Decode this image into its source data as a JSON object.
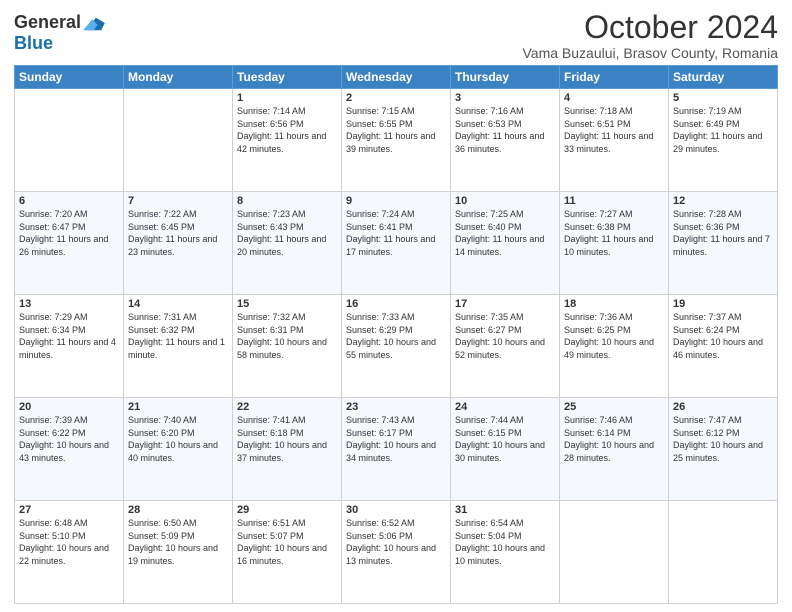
{
  "logo": {
    "general": "General",
    "blue": "Blue"
  },
  "title": "October 2024",
  "location": "Vama Buzaului, Brasov County, Romania",
  "days_of_week": [
    "Sunday",
    "Monday",
    "Tuesday",
    "Wednesday",
    "Thursday",
    "Friday",
    "Saturday"
  ],
  "weeks": [
    [
      {
        "day": "",
        "sunrise": "",
        "sunset": "",
        "daylight": ""
      },
      {
        "day": "",
        "sunrise": "",
        "sunset": "",
        "daylight": ""
      },
      {
        "day": "1",
        "sunrise": "Sunrise: 7:14 AM",
        "sunset": "Sunset: 6:56 PM",
        "daylight": "Daylight: 11 hours and 42 minutes."
      },
      {
        "day": "2",
        "sunrise": "Sunrise: 7:15 AM",
        "sunset": "Sunset: 6:55 PM",
        "daylight": "Daylight: 11 hours and 39 minutes."
      },
      {
        "day": "3",
        "sunrise": "Sunrise: 7:16 AM",
        "sunset": "Sunset: 6:53 PM",
        "daylight": "Daylight: 11 hours and 36 minutes."
      },
      {
        "day": "4",
        "sunrise": "Sunrise: 7:18 AM",
        "sunset": "Sunset: 6:51 PM",
        "daylight": "Daylight: 11 hours and 33 minutes."
      },
      {
        "day": "5",
        "sunrise": "Sunrise: 7:19 AM",
        "sunset": "Sunset: 6:49 PM",
        "daylight": "Daylight: 11 hours and 29 minutes."
      }
    ],
    [
      {
        "day": "6",
        "sunrise": "Sunrise: 7:20 AM",
        "sunset": "Sunset: 6:47 PM",
        "daylight": "Daylight: 11 hours and 26 minutes."
      },
      {
        "day": "7",
        "sunrise": "Sunrise: 7:22 AM",
        "sunset": "Sunset: 6:45 PM",
        "daylight": "Daylight: 11 hours and 23 minutes."
      },
      {
        "day": "8",
        "sunrise": "Sunrise: 7:23 AM",
        "sunset": "Sunset: 6:43 PM",
        "daylight": "Daylight: 11 hours and 20 minutes."
      },
      {
        "day": "9",
        "sunrise": "Sunrise: 7:24 AM",
        "sunset": "Sunset: 6:41 PM",
        "daylight": "Daylight: 11 hours and 17 minutes."
      },
      {
        "day": "10",
        "sunrise": "Sunrise: 7:25 AM",
        "sunset": "Sunset: 6:40 PM",
        "daylight": "Daylight: 11 hours and 14 minutes."
      },
      {
        "day": "11",
        "sunrise": "Sunrise: 7:27 AM",
        "sunset": "Sunset: 6:38 PM",
        "daylight": "Daylight: 11 hours and 10 minutes."
      },
      {
        "day": "12",
        "sunrise": "Sunrise: 7:28 AM",
        "sunset": "Sunset: 6:36 PM",
        "daylight": "Daylight: 11 hours and 7 minutes."
      }
    ],
    [
      {
        "day": "13",
        "sunrise": "Sunrise: 7:29 AM",
        "sunset": "Sunset: 6:34 PM",
        "daylight": "Daylight: 11 hours and 4 minutes."
      },
      {
        "day": "14",
        "sunrise": "Sunrise: 7:31 AM",
        "sunset": "Sunset: 6:32 PM",
        "daylight": "Daylight: 11 hours and 1 minute."
      },
      {
        "day": "15",
        "sunrise": "Sunrise: 7:32 AM",
        "sunset": "Sunset: 6:31 PM",
        "daylight": "Daylight: 10 hours and 58 minutes."
      },
      {
        "day": "16",
        "sunrise": "Sunrise: 7:33 AM",
        "sunset": "Sunset: 6:29 PM",
        "daylight": "Daylight: 10 hours and 55 minutes."
      },
      {
        "day": "17",
        "sunrise": "Sunrise: 7:35 AM",
        "sunset": "Sunset: 6:27 PM",
        "daylight": "Daylight: 10 hours and 52 minutes."
      },
      {
        "day": "18",
        "sunrise": "Sunrise: 7:36 AM",
        "sunset": "Sunset: 6:25 PM",
        "daylight": "Daylight: 10 hours and 49 minutes."
      },
      {
        "day": "19",
        "sunrise": "Sunrise: 7:37 AM",
        "sunset": "Sunset: 6:24 PM",
        "daylight": "Daylight: 10 hours and 46 minutes."
      }
    ],
    [
      {
        "day": "20",
        "sunrise": "Sunrise: 7:39 AM",
        "sunset": "Sunset: 6:22 PM",
        "daylight": "Daylight: 10 hours and 43 minutes."
      },
      {
        "day": "21",
        "sunrise": "Sunrise: 7:40 AM",
        "sunset": "Sunset: 6:20 PM",
        "daylight": "Daylight: 10 hours and 40 minutes."
      },
      {
        "day": "22",
        "sunrise": "Sunrise: 7:41 AM",
        "sunset": "Sunset: 6:18 PM",
        "daylight": "Daylight: 10 hours and 37 minutes."
      },
      {
        "day": "23",
        "sunrise": "Sunrise: 7:43 AM",
        "sunset": "Sunset: 6:17 PM",
        "daylight": "Daylight: 10 hours and 34 minutes."
      },
      {
        "day": "24",
        "sunrise": "Sunrise: 7:44 AM",
        "sunset": "Sunset: 6:15 PM",
        "daylight": "Daylight: 10 hours and 30 minutes."
      },
      {
        "day": "25",
        "sunrise": "Sunrise: 7:46 AM",
        "sunset": "Sunset: 6:14 PM",
        "daylight": "Daylight: 10 hours and 28 minutes."
      },
      {
        "day": "26",
        "sunrise": "Sunrise: 7:47 AM",
        "sunset": "Sunset: 6:12 PM",
        "daylight": "Daylight: 10 hours and 25 minutes."
      }
    ],
    [
      {
        "day": "27",
        "sunrise": "Sunrise: 6:48 AM",
        "sunset": "Sunset: 5:10 PM",
        "daylight": "Daylight: 10 hours and 22 minutes."
      },
      {
        "day": "28",
        "sunrise": "Sunrise: 6:50 AM",
        "sunset": "Sunset: 5:09 PM",
        "daylight": "Daylight: 10 hours and 19 minutes."
      },
      {
        "day": "29",
        "sunrise": "Sunrise: 6:51 AM",
        "sunset": "Sunset: 5:07 PM",
        "daylight": "Daylight: 10 hours and 16 minutes."
      },
      {
        "day": "30",
        "sunrise": "Sunrise: 6:52 AM",
        "sunset": "Sunset: 5:06 PM",
        "daylight": "Daylight: 10 hours and 13 minutes."
      },
      {
        "day": "31",
        "sunrise": "Sunrise: 6:54 AM",
        "sunset": "Sunset: 5:04 PM",
        "daylight": "Daylight: 10 hours and 10 minutes."
      },
      {
        "day": "",
        "sunrise": "",
        "sunset": "",
        "daylight": ""
      },
      {
        "day": "",
        "sunrise": "",
        "sunset": "",
        "daylight": ""
      }
    ]
  ]
}
